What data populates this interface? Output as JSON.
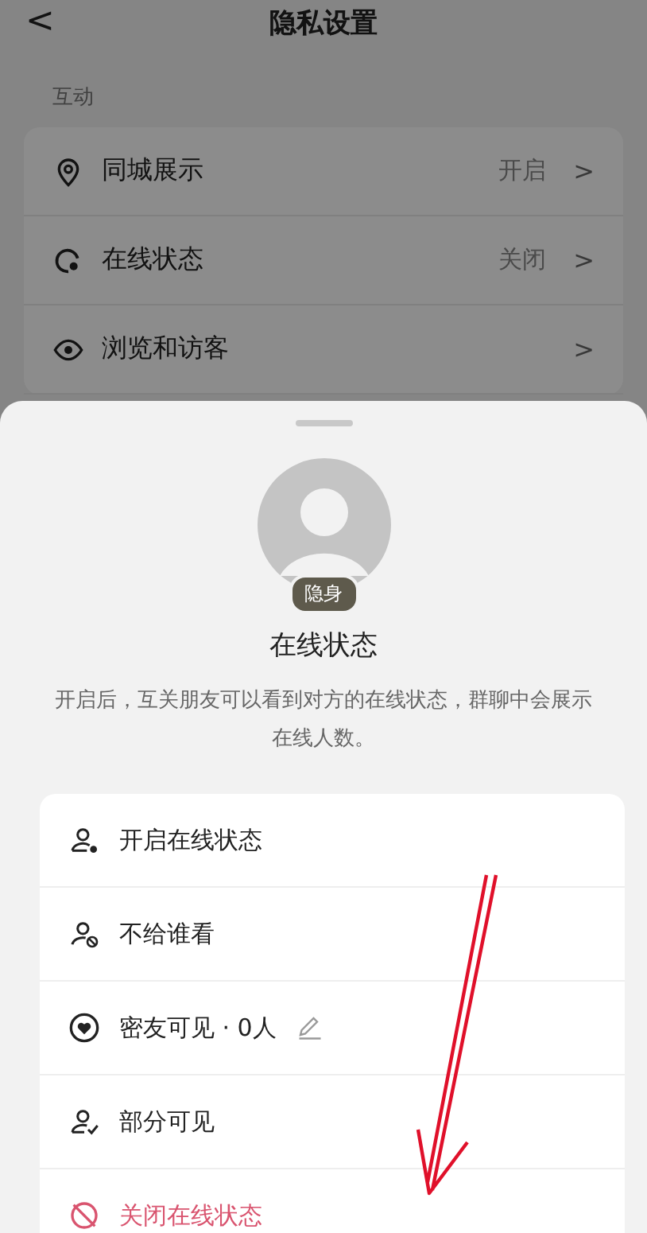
{
  "header": {
    "back": "<",
    "title": "隐私设置"
  },
  "section": {
    "title": "互动",
    "rows": [
      {
        "label": "同城展示",
        "value": "开启",
        "chevron": ">"
      },
      {
        "label": "在线状态",
        "value": "关闭",
        "chevron": ">"
      },
      {
        "label": "浏览和访客",
        "chevron": ">"
      }
    ]
  },
  "sheet": {
    "badge": "隐身",
    "title": "在线状态",
    "description": "开启后，互关朋友可以看到对方的在线状态，群聊中会展示在线人数。",
    "options": [
      {
        "label": "开启在线状态",
        "kind": "normal"
      },
      {
        "label": "不给谁看",
        "kind": "normal"
      },
      {
        "label": "密友可见 · 0人",
        "kind": "editable"
      },
      {
        "label": "部分可见",
        "kind": "normal"
      },
      {
        "label": "关闭在线状态",
        "kind": "danger"
      }
    ]
  }
}
